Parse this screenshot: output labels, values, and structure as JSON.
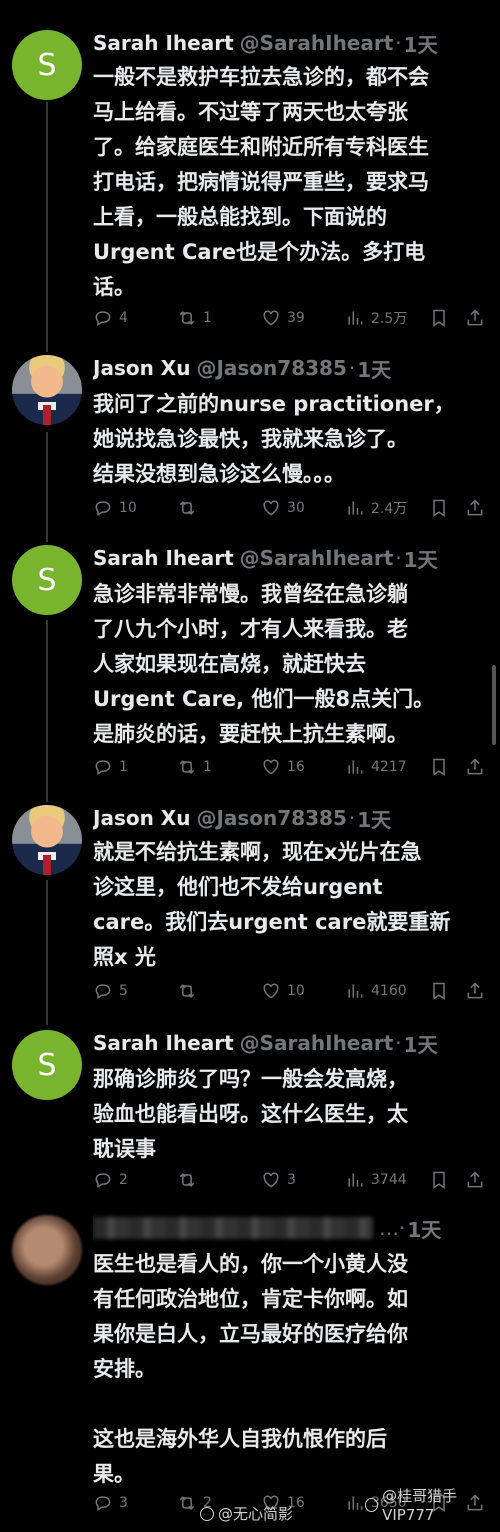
{
  "tweets": [
    {
      "name": "Sarah Iheart",
      "handle": "@SarahIheart",
      "time": "1天",
      "avatar_letter": "S",
      "body": "一般不是救护车拉去急诊的，都不会\n马上给看。不过等了两天也太夸张\n了。给家庭医生和附近所有专科医生\n打电话，把病情说得严重些，要求马\n上看，一般总能找到。下面说的\nUrgent Care也是个办法。多打电\n话。",
      "replies": "4",
      "retweets": "1",
      "likes": "39",
      "views": "2.5万"
    },
    {
      "name": "Jason Xu",
      "handle": "@Jason78385",
      "time": "1天",
      "body": "我问了之前的nurse practitioner，\n她说找急诊最快，我就来急诊了。\n结果没想到急诊这么慢。。。",
      "replies": "10",
      "retweets": "",
      "likes": "30",
      "views": "2.4万"
    },
    {
      "name": "Sarah Iheart",
      "handle": "@SarahIheart",
      "time": "1天",
      "avatar_letter": "S",
      "body": "急诊非常非常慢。我曾经在急诊躺\n了八九个小时，才有人来看我。老\n人家如果现在高烧，就赶快去\nUrgent Care, 他们一般8点关门。\n是肺炎的话，要赶快上抗生素啊。",
      "replies": "1",
      "retweets": "1",
      "likes": "16",
      "views": "4217"
    },
    {
      "name": "Jason Xu",
      "handle": "@Jason78385",
      "time": "1天",
      "body": "就是不给抗生素啊，现在x光片在急\n诊这里，他们也不发给urgent\ncare。我们去urgent care就要重新\n照x 光",
      "replies": "5",
      "retweets": "",
      "likes": "10",
      "views": "4160"
    },
    {
      "name": "Sarah Iheart",
      "handle": "@SarahIheart",
      "time": "1天",
      "avatar_letter": "S",
      "body": "那确诊肺炎了吗？一般会发高烧，\n验血也能看出呀。这什么医生，太\n耽误事",
      "replies": "2",
      "retweets": "",
      "likes": "3",
      "views": "3744"
    },
    {
      "name": "",
      "handle": "",
      "time": "1天",
      "body": "医生也是看人的，你一个小黄人没\n有任何政治地位，肯定卡你啊。如\n果你是白人，立马最好的医疗给你\n安排。\n\n这也是海外华人自我仇恨作的后\n果。",
      "replies": "3",
      "retweets": "2",
      "likes": "16",
      "views": "3650"
    }
  ],
  "watermarks": {
    "left": "@无心简影",
    "right": "@桂哥猎手VIP777"
  },
  "colors": {
    "background": "#000000",
    "text": "#e7e9ea",
    "muted": "#71767b",
    "avatar_s": "#79b42f"
  },
  "icons": [
    "reply-icon",
    "retweet-icon",
    "like-icon",
    "views-icon",
    "bookmark-icon",
    "share-icon"
  ]
}
